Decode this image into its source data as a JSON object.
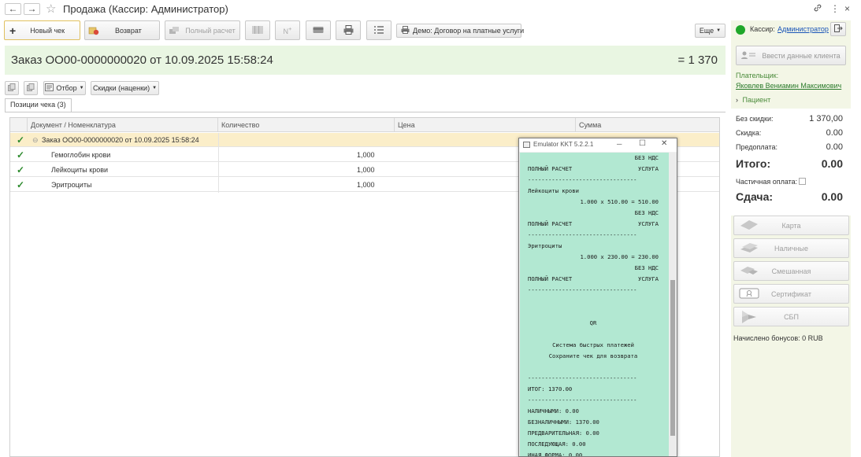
{
  "window": {
    "title": "Продажа (Кассир: Администратор)",
    "back_glyph": "←",
    "forward_glyph": "→",
    "star_glyph": "☆",
    "link_glyph": "🔗",
    "more_glyph": "⋮",
    "close_glyph": "×"
  },
  "toolbar": {
    "new_check": "Новый чек",
    "new_check_glyph": "+",
    "return": "Возврат",
    "full_payment": "Полный расчет",
    "demo_contract": "Демо: Договор на платные услуги",
    "more": "Еще"
  },
  "order": {
    "title": "Заказ ОО00-0000000020 от 10.09.2025 15:58:24",
    "total": "= 1 370"
  },
  "filter_bar": {
    "filter": "Отбор",
    "discounts": "Скидки (наценки)"
  },
  "tab": {
    "label": "Позиции чека (3)"
  },
  "table": {
    "columns": [
      "Документ / Номенклатура",
      "Количество",
      "Цена",
      "Сумма"
    ],
    "rows": [
      {
        "check": "✓",
        "toggle": "⊖",
        "name": "Заказ ОО00-0000000020 от 10.09.2025 15:58:24",
        "qty": "",
        "selected": true
      },
      {
        "check": "✓",
        "name": "Гемоглобин крови",
        "qty": "1,000"
      },
      {
        "check": "✓",
        "name": "Лейкоциты крови",
        "qty": "1,000"
      },
      {
        "check": "✓",
        "name": "Эритроциты",
        "qty": "1,000"
      }
    ]
  },
  "right_panel": {
    "cashier_label": "Кассир:",
    "cashier_name": "Администратор",
    "enter_client": "Ввести данные клиента",
    "payer_label": "Плательщик:",
    "payer_name": "Яковлев Вениамин Максимович",
    "patient_label": "Пациент",
    "without_discount_label": "Без скидки:",
    "without_discount_value": "1 370,00",
    "discount_label": "Скидка:",
    "discount_value": "0.00",
    "prepayment_label": "Предоплата:",
    "prepayment_value": "0.00",
    "total_label": "Итого:",
    "total_value": "0.00",
    "partial_payment_label": "Частичная оплата:",
    "change_label": "Сдача:",
    "change_value": "0.00",
    "pay_card": "Карта",
    "pay_cash": "Наличные",
    "pay_mixed": "Смешанная",
    "pay_certificate": "Сертификат",
    "pay_sbp": "СБП",
    "bonus": "Начислено бонусов: 0 RUB"
  },
  "emulator": {
    "title": "Emulator KKT 5.2.2.1",
    "min_glyph": "─",
    "max_glyph": "☐",
    "close_glyph": "✕",
    "receipt": {
      "no_vat": "БЕЗ НДС",
      "full_payment": "ПОЛНЫЙ РАСЧЕТ",
      "service": "УСЛУГА",
      "separator": "--------------------------------",
      "item2_name": "Лейкоциты крови",
      "item2_calc": "1.000 x 510.00 = 510.00",
      "item3_name": "Эритроциты",
      "item3_calc": "1.000 x 230.00 = 230.00",
      "qr": "QR",
      "sbp_line": "Система быстрых платежей",
      "keep_line": "Сохраните чек для возврата",
      "total": "ИТОГ: 1370.00",
      "cash": "НАЛИЧНЫМИ: 0.00",
      "cashless": "БЕЗНАЛИЧНЫМИ: 1370.00",
      "prepaid": "ПРЕДВАРИТЕЛЬНАЯ: 0.00",
      "subsequent": "ПОСЛЕДУЮЩАЯ: 0.00",
      "other": "ИНАЯ ФОРМА: 0.00"
    }
  }
}
